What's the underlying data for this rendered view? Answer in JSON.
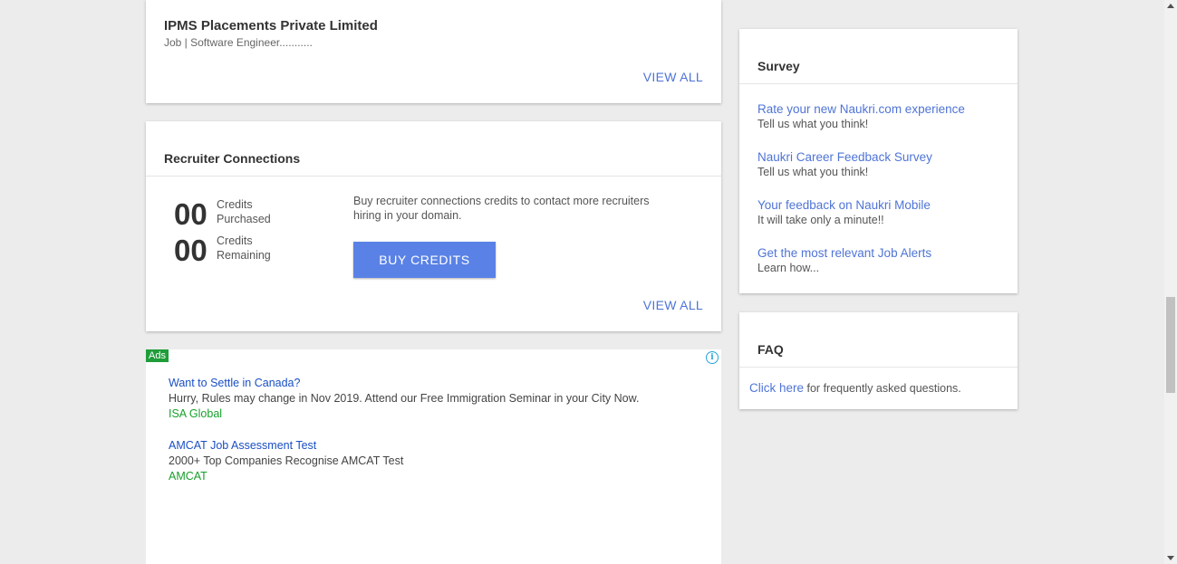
{
  "job_card": {
    "company": "IPMS Placements Private Limited",
    "subtitle": "Job | Software Engineer...........",
    "view_all": "VIEW ALL"
  },
  "recruiter": {
    "title": "Recruiter Connections",
    "purchased_count": "00",
    "purchased_label_1": "Credits",
    "purchased_label_2": "Purchased",
    "remaining_count": "00",
    "remaining_label_1": "Credits",
    "remaining_label_2": "Remaining",
    "description": "Buy recruiter connections credits to contact more recruiters hiring in your domain.",
    "buy_button": "BUY CREDITS",
    "view_all": "VIEW ALL"
  },
  "ads": {
    "badge": "Ads",
    "info_icon": "i",
    "items": [
      {
        "title": "Want to Settle in Canada?",
        "desc": "Hurry, Rules may change in Nov 2019. Attend our Free Immigration Seminar in your City Now.",
        "source": "ISA Global"
      },
      {
        "title": "AMCAT Job Assessment Test",
        "desc": "2000+ Top Companies Recognise AMCAT Test",
        "source": "AMCAT"
      }
    ]
  },
  "survey": {
    "title": "Survey",
    "items": [
      {
        "link": "Rate your new Naukri.com experience",
        "sub": "Tell us what you think!"
      },
      {
        "link": "Naukri Career Feedback Survey",
        "sub": "Tell us what you think!"
      },
      {
        "link": "Your feedback on Naukri Mobile",
        "sub": "It will take only a minute!!"
      },
      {
        "link": "Get the most relevant Job Alerts",
        "sub": "Learn how..."
      }
    ]
  },
  "faq": {
    "title": "FAQ",
    "link": "Click here",
    "text": " for frequently asked questions."
  },
  "colors": {
    "link": "#4f74d6",
    "button": "#5a82e6",
    "ad_title": "#1a4fc4",
    "ad_source": "#17a02b",
    "background": "#ececec"
  }
}
